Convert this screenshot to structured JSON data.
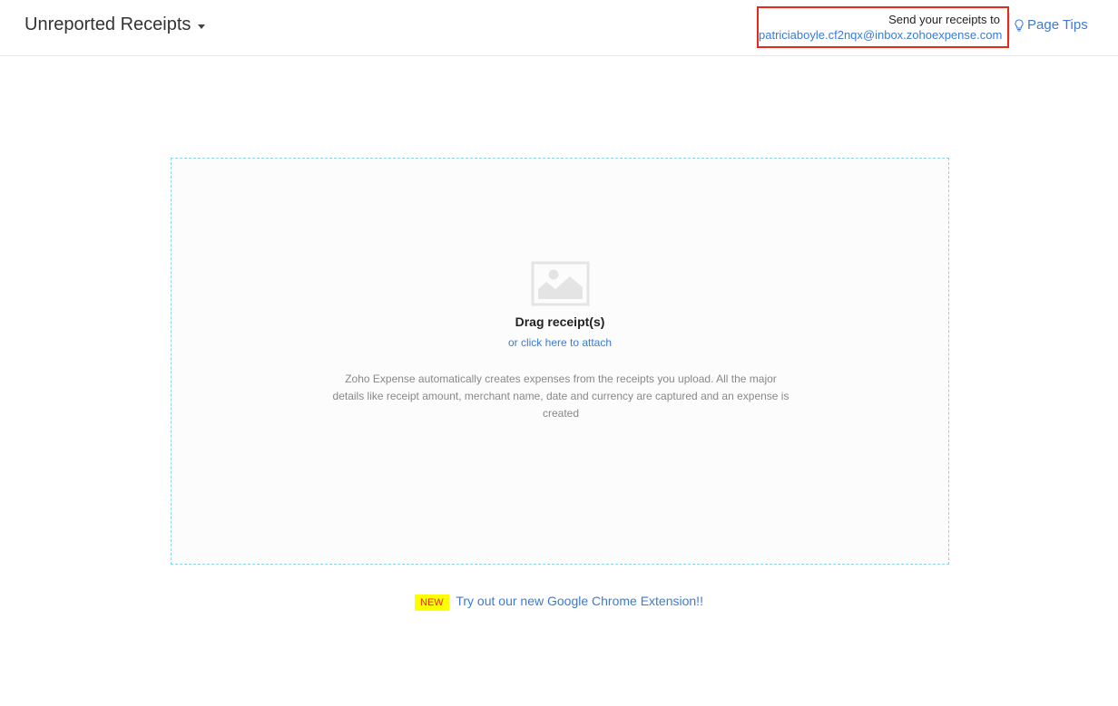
{
  "header": {
    "title": "Unreported Receipts",
    "send_label": "Send your receipts to",
    "email": "patriciaboyle.cf2nqx@inbox.zohoexpense.com",
    "page_tips": "Page Tips"
  },
  "dropzone": {
    "title": "Drag receipt(s)",
    "attach_link": "or click here to attach",
    "description": "Zoho Expense automatically creates expenses from the receipts you upload. All the major details like receipt amount, merchant name, date and currency are captured and an expense is created"
  },
  "promo": {
    "badge": "NEW",
    "link": "Try out our new Google Chrome Extension!!"
  }
}
